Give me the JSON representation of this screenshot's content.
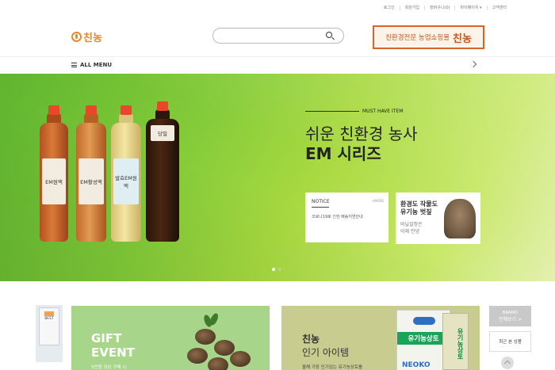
{
  "topbar": {
    "links": [
      "로그인",
      "회원가입",
      "장바구니(0)",
      "마이페이지 ▾",
      "고객센터"
    ]
  },
  "header": {
    "logo_text": "친농",
    "logo_icon": "sprout-drop-icon",
    "search_placeholder": "",
    "ad_tagline": "친환경전문 농업쇼핑몰",
    "ad_brand": "친농"
  },
  "nav": {
    "all_menu_label": "ALL MENU"
  },
  "hero": {
    "kicker": "MUST HAVE ITEM",
    "title_line1": "쉬운 친환경 농사",
    "title_line2": "EM 시리즈",
    "bottles": [
      "EM원액",
      "EM활성액",
      "발효EM원액",
      "당밀"
    ],
    "notice": {
      "title": "NOTICE",
      "more": "+MORE",
      "item": "코로나19로 인한 배송지연안내"
    },
    "promo": {
      "line1": "환경도 작물도",
      "line2": "유기농 벗짚",
      "line3": "비닐걸정은",
      "line4": "이제 안녕"
    }
  },
  "lower": {
    "left_badge": "BEST",
    "gift": {
      "line1": "GIFT",
      "line2": "EVENT",
      "caption": "5만원 이상 구매 시"
    },
    "popular": {
      "line1": "친농",
      "line2": "인기 아이템",
      "caption": "올해 가장 인기있는 유기농상토를",
      "bag_label": "유기농상토",
      "bag_brand": "NEOKO",
      "bag2_label": "유기농상토"
    },
    "side": {
      "brand_title": "BRAND",
      "brand_all": "전체보기 >",
      "recent": "최근 본 상품",
      "top": "TOP"
    }
  }
}
